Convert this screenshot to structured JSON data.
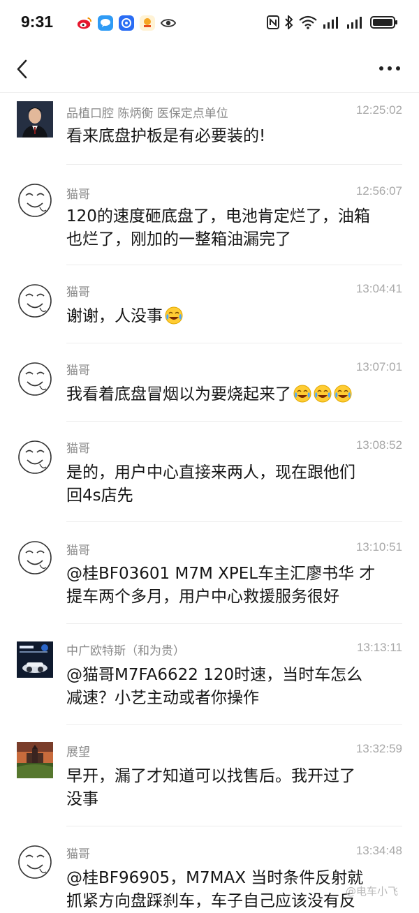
{
  "status_bar": {
    "time": "9:31",
    "app_icons": [
      "weibo-icon",
      "message-icon",
      "browser-icon",
      "app-icon",
      "eye-icon"
    ],
    "right_icons": [
      "nfc-icon",
      "bluetooth-icon",
      "wifi-icon",
      "signal-icon",
      "signal-icon",
      "battery-icon"
    ]
  },
  "nav": {
    "back_icon": "chevron-left-icon",
    "more_icon": "more-icon"
  },
  "comments": [
    {
      "name": "品植口腔  陈炳衡  医保定点单位",
      "time": "12:25:02",
      "line1": "看来底盘护板是有必要装的!",
      "line2": "",
      "emoji_count": 0,
      "avatar": "photo-man"
    },
    {
      "name": "猫哥",
      "time": "12:56:07",
      "line1": "120的速度砸底盘了，电池肯定烂了，油箱",
      "line2": "也烂了，刚加的一整箱油漏完了",
      "emoji_count": 0,
      "avatar": "smiley-sketch"
    },
    {
      "name": "猫哥",
      "time": "13:04:41",
      "line1": "谢谢，人没事",
      "line2": "",
      "emoji_count": 1,
      "avatar": "smiley-sketch"
    },
    {
      "name": "猫哥",
      "time": "13:07:01",
      "line1": "我看着底盘冒烟以为要烧起来了",
      "line2": "",
      "emoji_count": 3,
      "avatar": "smiley-sketch"
    },
    {
      "name": "猫哥",
      "time": "13:08:52",
      "line1": "是的，用户中心直接来两人，现在跟他们",
      "line2": "回4s店先",
      "emoji_count": 0,
      "avatar": "smiley-sketch"
    },
    {
      "name": "猫哥",
      "time": "13:10:51",
      "line1": "@桂BF03601 M7M XPEL车主汇廖书华 才",
      "line2": "提车两个多月，用户中心救援服务很好",
      "emoji_count": 0,
      "avatar": "smiley-sketch"
    },
    {
      "name": "中广欧特斯（和为贵）",
      "time": "13:13:11",
      "line1": "@猫哥M7FA6622 120时速，当时车怎么",
      "line2": "减速？小艺主动或者你操作",
      "emoji_count": 0,
      "avatar": "brand-dark"
    },
    {
      "name": "展望",
      "time": "13:32:59",
      "line1": "早开，漏了才知道可以找售后。我开过了",
      "line2": "没事",
      "emoji_count": 0,
      "avatar": "landscape-castle"
    },
    {
      "name": "猫哥",
      "time": "13:34:48",
      "line1": "@桂BF96905，M7MAX 当时条件反射就",
      "line2": "抓紧方向盘踩刹车，车子自己应该没有反",
      "emoji_count": 0,
      "avatar": "smiley-sketch"
    }
  ],
  "emoji_name": "laugh-cry-emoji",
  "watermark": "@电车小飞"
}
